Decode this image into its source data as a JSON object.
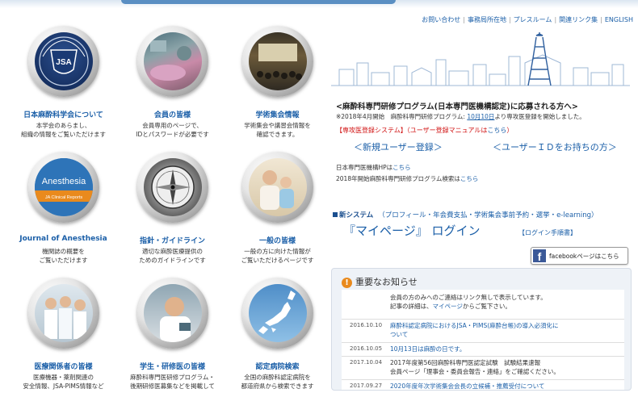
{
  "top_links": [
    "お問い合わせ",
    "事務局所在地",
    "プレスルーム",
    "関連リンク集",
    "ENGLISH"
  ],
  "logo_text": "JSA",
  "tiles": [
    {
      "title": "日本麻酔科学会について",
      "desc1": "本学会のあらまし、",
      "desc2": "組織の情報をご覧いただけます"
    },
    {
      "title": "会員の皆様",
      "desc1": "会員専用のページで、",
      "desc2": "IDとパスワードが必要です"
    },
    {
      "title": "学術集会情報",
      "desc1": "学術集会や講習会情報を",
      "desc2": "確認できます。"
    },
    {
      "title": "Journal of Anesthesia",
      "desc1": "機関誌の概要を",
      "desc2": "ご覧いただけます"
    },
    {
      "title": "指針・ガイドライン",
      "desc1": "適切な麻酔医療提供の",
      "desc2": "ためのガイドラインです"
    },
    {
      "title": "一般の皆様",
      "desc1": "一般の方に向けた情報が",
      "desc2": "ご覧いただけるページです"
    },
    {
      "title": "医療関係者の皆様",
      "desc1": "医療機器・薬剤関連の",
      "desc2": "安全情報、JSA-PIMS情報など"
    },
    {
      "title": "学生・研修医の皆様",
      "desc1": "麻酔科専門医研修プログラム・",
      "desc2": "後期研修医募集などを掲載して"
    },
    {
      "title": "認定病院検索",
      "desc1": "全国の麻酔科認定病院を",
      "desc2": "都道府県から検索できます"
    }
  ],
  "journal_cover": {
    "title": "Anesthesia",
    "subtitle": "JA Clinical Reports"
  },
  "recruit": {
    "title": "<麻酔科専門研修プログラム(日本専門医機構認定)に応募される方へ>",
    "note_pre": "※2018年4月開始　麻酔科専門研修プログラム:",
    "note_date": "10月10日",
    "note_post": "より専攻医登録を開始しました。",
    "sys_label": "【専攻医登録システム】",
    "sys_manual_pre": "（ユーザー登録マニュアルは",
    "sys_manual_link": "こちら",
    "sys_manual_post": "）",
    "new_user": "＜新規ユーザー登録＞",
    "have_id": "＜ユーザーＩＤをお持ちの方＞",
    "hp_pre": "日本専門医機構HPは",
    "hp_link": "こちら",
    "search_pre": "2018年開始麻酔科専門研修プログラム検索は",
    "search_link": "こちら"
  },
  "new_system": {
    "label": "新システム",
    "sub": "（プロフィール・年会費支払・学術集会事前予約・選挙・e-learning）",
    "mypage": "『マイページ』 ログイン",
    "login_help": "【ログイン手順書】"
  },
  "facebook": {
    "label": "facebookページはこちら"
  },
  "notice": {
    "heading": "重要なお知らせ",
    "intro1": "会員の方のみへのご連絡はリンク無しで表示しています。",
    "intro2_pre": "記事の詳細は、",
    "intro2_link": "マイページ",
    "intro2_post": "からご覧下さい。",
    "items": [
      {
        "date": "2016.10.10",
        "line1": "麻酔科認定病院におけるJSA・PIMS(麻酔台帳)の導入必須化に",
        "line2": "ついて"
      },
      {
        "date": "2016.10.05",
        "line1": "10月13日は麻酔の日です。",
        "line2": ""
      },
      {
        "date": "2017.10.04",
        "line1": "2017年度第56回麻酔科専門医認定試験　試験結果速報",
        "line2": "会員ページ「理事会・委員会報告・連絡」をご確認ください。"
      },
      {
        "date": "2017.09.27",
        "line1": "2020年度年次学術集会会長の立候補・推薦受付について",
        "line2": ""
      }
    ]
  }
}
